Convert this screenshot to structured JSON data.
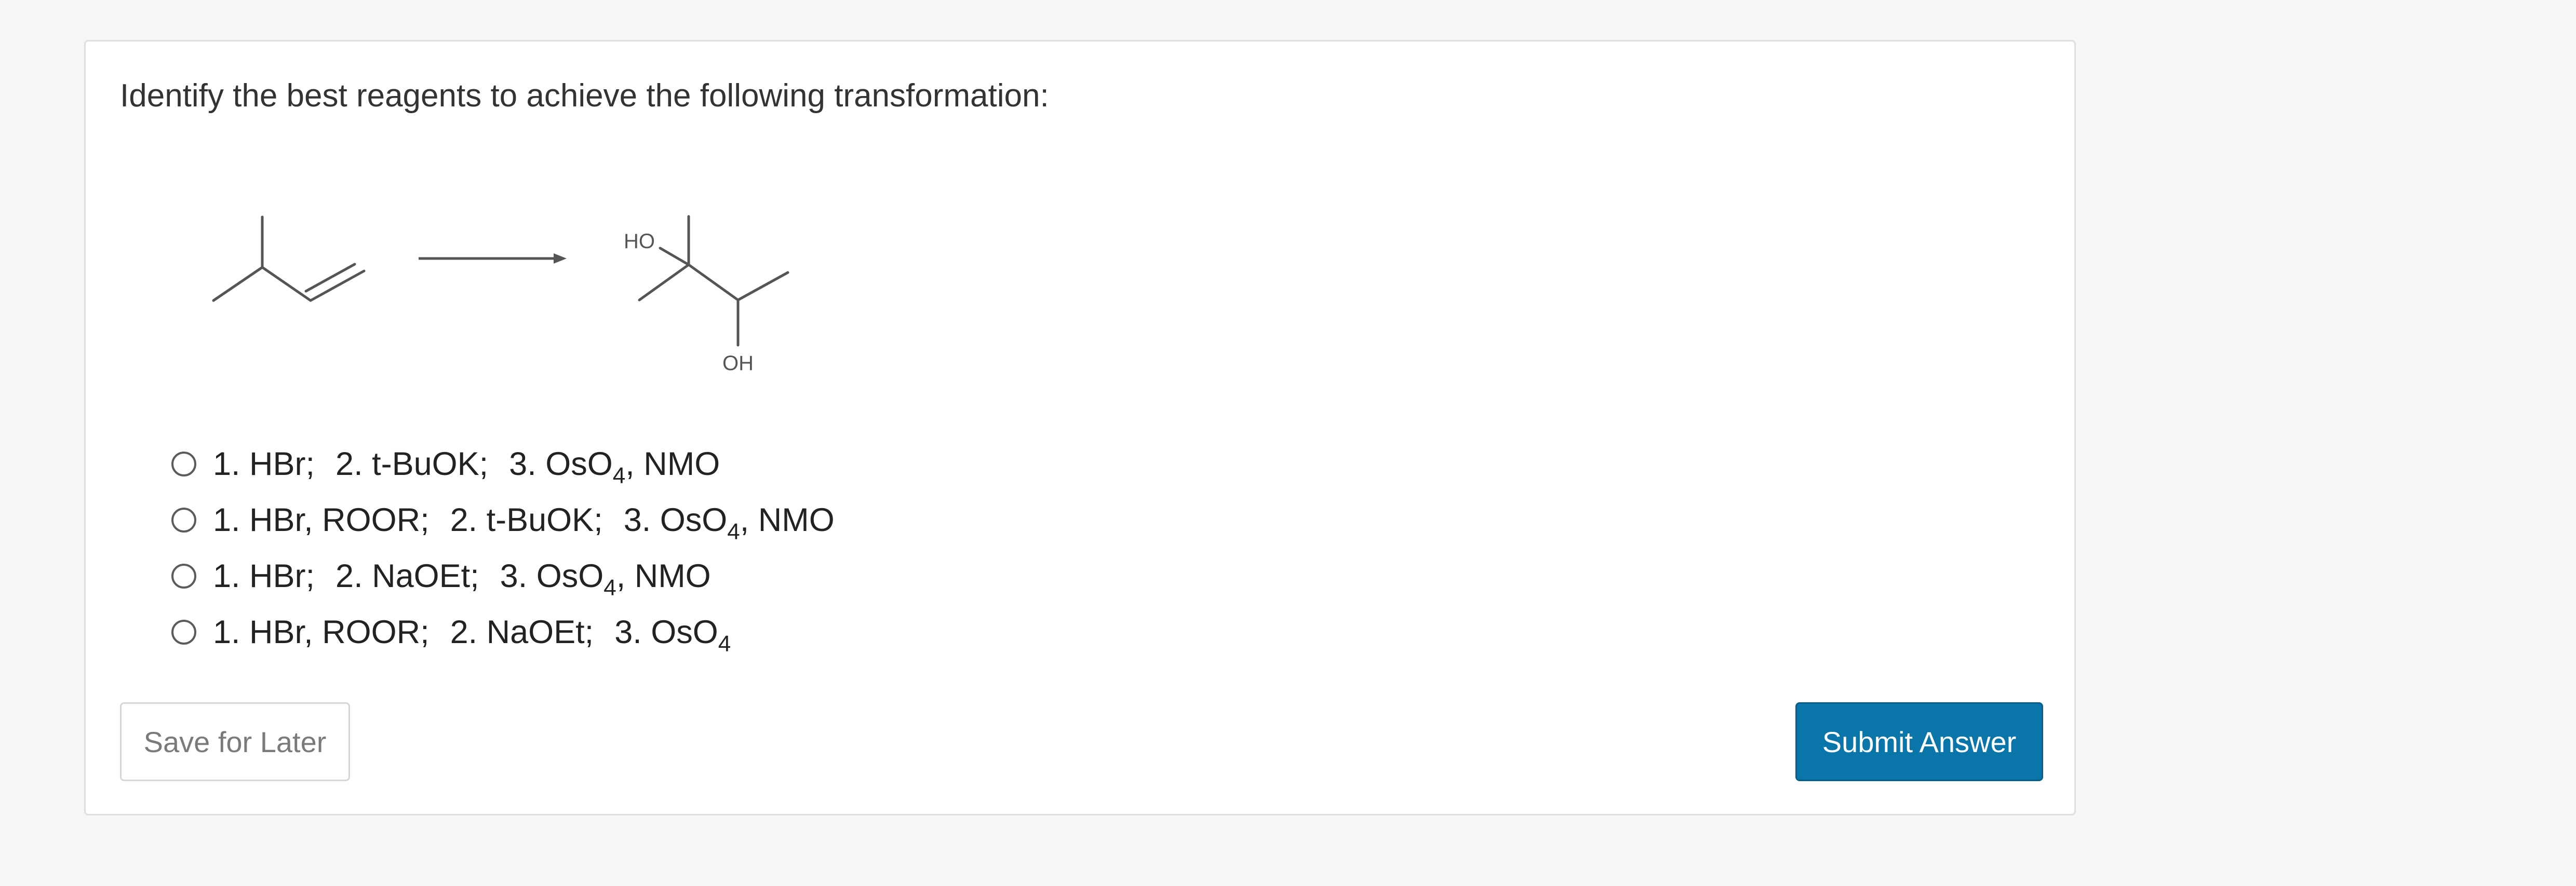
{
  "question": {
    "prompt": "Identify the best reagents to achieve the following transformation:"
  },
  "reaction": {
    "product_labels": {
      "hydroxyl_top": "HO",
      "hydroxyl_bottom": "OH"
    }
  },
  "choices": [
    {
      "selected": false,
      "steps": [
        {
          "text": "1. HBr;"
        },
        {
          "text": "2. t-BuOK;"
        },
        {
          "text": "3. OsO",
          "sub": "4",
          "after": ", NMO"
        }
      ]
    },
    {
      "selected": false,
      "steps": [
        {
          "text": "1. HBr, ROOR;"
        },
        {
          "text": "2. t-BuOK;"
        },
        {
          "text": "3. OsO",
          "sub": "4",
          "after": ", NMO"
        }
      ]
    },
    {
      "selected": false,
      "steps": [
        {
          "text": "1. HBr;"
        },
        {
          "text": "2. NaOEt;"
        },
        {
          "text": "3. OsO",
          "sub": "4",
          "after": ", NMO"
        }
      ]
    },
    {
      "selected": false,
      "steps": [
        {
          "text": "1. HBr, ROOR;"
        },
        {
          "text": "2. NaOEt;"
        },
        {
          "text": "3. OsO",
          "sub": "4",
          "after": ""
        }
      ]
    }
  ],
  "buttons": {
    "save_label": "Save for Later",
    "submit_label": "Submit Answer"
  },
  "colors": {
    "submit_background": "#0a75a8",
    "page_background": "#f6f6f6",
    "bond_stroke": "#555555"
  }
}
